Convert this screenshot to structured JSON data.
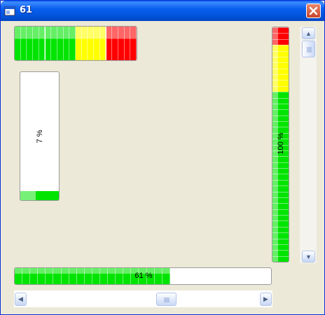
{
  "window": {
    "title": "61",
    "close_icon": "close-icon",
    "app_icon": "app-window-icon"
  },
  "progress_top": {
    "value": 1.0,
    "label": "",
    "segments_green": 10,
    "segments_yellow": 5,
    "segments_red": 5,
    "colors": {
      "green": "#00E400",
      "yellow": "#FFFF00",
      "red": "#FF0000"
    }
  },
  "progress_small_vertical": {
    "value": 0.07,
    "label": "7 %",
    "colors": {
      "green": "#00E400"
    }
  },
  "progress_tall_vertical": {
    "value": 1.0,
    "label": "100 %",
    "colors": {
      "green": "#00E400",
      "yellow": "#FFFF00",
      "red": "#FF0000"
    }
  },
  "progress_bottom": {
    "value": 0.61,
    "label": "61 %",
    "colors": {
      "green": "#00E400"
    }
  },
  "vscroll": {
    "value": 0.08,
    "up_icon": "up-arrow-icon",
    "down_icon": "down-arrow-icon",
    "grip_icon": "grip-icon"
  },
  "hscroll": {
    "value": 0.58,
    "left_icon": "left-arrow-icon",
    "right_icon": "right-arrow-icon",
    "grip_icon": "grip-icon"
  }
}
